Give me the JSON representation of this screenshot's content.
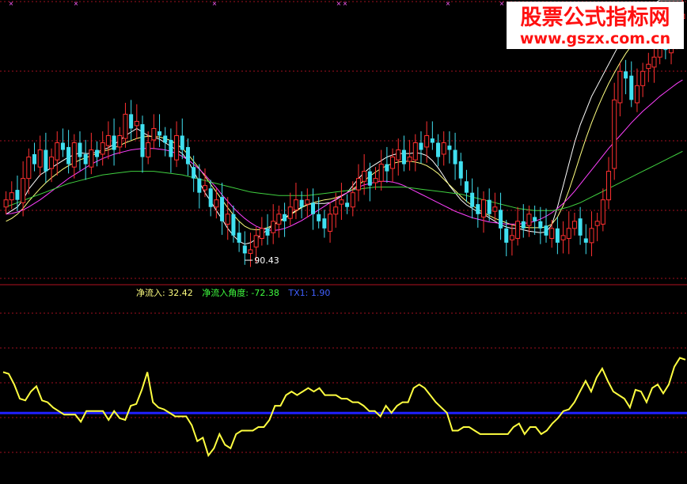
{
  "watermark": {
    "title": "股票公式指标网",
    "url": "www.gszx.com.cn"
  },
  "colors": {
    "background": "#000000",
    "grid": "#a01020",
    "divider": "#b01020",
    "up_candle": "#ff3030",
    "down_candle": "#40e0f0",
    "ma_short": "#ffffff",
    "ma_mid": "#ffff80",
    "ma_long": "#ff40ff",
    "ma_longest": "#40d040",
    "indicator_line": "#ffff40",
    "zero_line": "#2020ff",
    "label_yellow": "#ffff80",
    "label_green": "#40ff40",
    "label_blue": "#4060ff",
    "marker": "#ff60ff",
    "watermark_red": "#ff1010"
  },
  "chart_data": [
    {
      "type": "candlestick",
      "panel": "price",
      "low_annotation": {
        "value": "90.43",
        "bar_index": 42
      },
      "ylim": [
        87,
        126
      ],
      "bars_close": [
        98,
        99,
        98,
        101,
        104,
        103,
        105,
        102,
        104,
        106,
        105,
        103,
        106,
        104,
        103,
        105,
        104,
        106,
        107,
        105,
        107,
        110,
        108,
        109,
        104,
        106,
        108,
        107,
        106,
        104,
        107,
        105,
        103,
        101,
        99,
        100,
        97,
        98,
        95,
        96,
        93,
        92,
        90.5,
        91,
        93,
        94,
        93,
        95,
        96,
        95,
        97,
        98,
        97,
        98,
        96,
        95,
        94,
        96,
        97,
        98,
        97,
        99,
        101,
        102,
        100,
        101,
        103,
        102,
        104,
        105,
        103,
        104,
        106,
        105,
        107,
        106,
        104,
        106,
        105,
        103,
        101,
        99,
        97,
        96,
        98,
        96,
        97,
        94,
        92,
        93,
        95,
        94,
        96,
        95,
        94,
        93,
        94,
        92,
        93,
        94,
        95,
        93,
        92,
        94,
        95,
        98,
        102,
        112,
        116,
        115,
        112,
        114,
        116,
        117,
        118,
        120,
        119,
        121,
        123,
        124
      ],
      "ma_lines": [
        {
          "values": [
            96,
            96.5,
            97,
            98,
            99.5,
            100.5,
            101.5,
            102,
            102.5,
            103,
            103.5,
            104,
            104.3,
            104.6,
            104.5,
            104.5,
            104.7,
            105,
            105.3,
            105.8,
            106.3,
            107,
            107.5,
            108,
            107.5,
            107,
            106.8,
            106.5,
            106,
            105.5,
            105,
            104.5,
            103.5,
            102,
            100.5,
            99,
            97.8,
            96.5,
            95.3,
            94,
            93,
            92.2,
            91.8,
            92,
            92.5,
            93.2,
            93.8,
            94.5,
            95,
            95.5,
            96,
            96.5,
            97,
            97.3,
            97.5,
            97.5,
            97.5,
            97.6,
            98,
            98.5,
            99,
            100,
            101,
            101.8,
            102.5,
            103,
            103.5,
            104,
            104.3,
            104.5,
            104.5,
            104.5,
            104.6,
            104.5,
            104.2,
            103.5,
            102.5,
            101.3,
            100,
            99,
            98,
            97.3,
            96.8,
            96.3,
            96,
            95.5,
            95,
            94.5,
            94.2,
            94,
            94,
            93.8,
            93.6,
            93.5,
            93.4,
            93.5,
            94.5,
            97,
            100,
            103,
            106,
            108.5,
            110.5,
            112.5,
            114,
            115.5,
            117,
            118.5,
            120,
            121.5,
            122.5,
            123.5,
            124.5,
            125,
            125.5,
            126,
            126,
            126,
            126,
            126
          ]
        },
        {
          "values": [
            95,
            95.4,
            96,
            96.8,
            97.8,
            98.7,
            99.6,
            100.4,
            101.1,
            101.7,
            102.3,
            102.8,
            103.2,
            103.6,
            103.9,
            104.2,
            104.5,
            104.8,
            105,
            105.3,
            105.6,
            106,
            106.3,
            106.6,
            106.8,
            106.9,
            106.9,
            106.8,
            106.6,
            106.3,
            105.8,
            105.2,
            104.4,
            103.4,
            102.4,
            101.3,
            100.2,
            99.1,
            98,
            96.9,
            95.9,
            95,
            94.3,
            93.9,
            93.8,
            93.9,
            94.1,
            94.5,
            94.9,
            95.4,
            95.9,
            96.4,
            96.9,
            97.3,
            97.6,
            97.8,
            98,
            98.1,
            98.3,
            98.6,
            99,
            99.5,
            100.1,
            100.7,
            101.3,
            101.9,
            102.4,
            102.8,
            103.1,
            103.3,
            103.4,
            103.4,
            103.3,
            103.1,
            102.8,
            102.3,
            101.7,
            100.9,
            100.1,
            99.3,
            98.5,
            97.8,
            97.2,
            96.7,
            96.2,
            95.8,
            95.4,
            95.1,
            94.8,
            94.5,
            94.3,
            94.2,
            94.1,
            94.1,
            94.1,
            94.2,
            94.6,
            95.6,
            97.2,
            99.3,
            101.7,
            104.2,
            106.6,
            108.8,
            110.8,
            112.6,
            114.3,
            115.8,
            117.2,
            118.5,
            119.6,
            120.6,
            121.5,
            122.3,
            123,
            123.6,
            124.1,
            124.5,
            124.8,
            125
          ]
        },
        {
          "values": [
            96,
            96.1,
            96.3,
            96.6,
            97,
            97.5,
            98,
            98.6,
            99.2,
            99.8,
            100.4,
            101,
            101.5,
            102,
            102.5,
            103,
            103.4,
            103.8,
            104.1,
            104.4,
            104.6,
            104.8,
            105,
            105.1,
            105.2,
            105.2,
            105.2,
            105.1,
            105,
            104.8,
            104.5,
            104.1,
            103.6,
            103,
            102.3,
            101.5,
            100.6,
            99.7,
            98.7,
            97.8,
            96.9,
            96.1,
            95.4,
            94.8,
            94.3,
            94,
            93.8,
            93.7,
            93.8,
            94,
            94.3,
            94.7,
            95.1,
            95.6,
            96.1,
            96.6,
            97.1,
            97.6,
            98.1,
            98.6,
            99,
            99.4,
            99.8,
            100.1,
            100.3,
            100.5,
            100.6,
            100.6,
            100.5,
            100.3,
            100,
            99.6,
            99.2,
            98.8,
            98.4,
            98,
            97.6,
            97.2,
            96.8,
            96.4,
            96.1,
            95.8,
            95.5,
            95.3,
            95.1,
            94.9,
            94.8,
            94.7,
            94.6,
            94.6,
            94.6,
            94.7,
            94.8,
            95,
            95.3,
            95.7,
            96.2,
            96.8,
            97.5,
            98.3,
            99.2,
            100.2,
            101.2,
            102.2,
            103.2,
            104.2,
            105.2,
            106.1,
            107,
            107.9,
            108.8,
            109.6,
            110.4,
            111.1,
            111.8,
            112.5,
            113.1,
            113.7,
            114.3,
            114.8
          ]
        },
        {
          "values": [
            97,
            97.3,
            97.6,
            97.9,
            98.2,
            98.5,
            98.8,
            99.1,
            99.4,
            99.7,
            100,
            100.3,
            100.5,
            100.7,
            100.9,
            101.1,
            101.3,
            101.5,
            101.6,
            101.7,
            101.8,
            101.9,
            102,
            102,
            102,
            102,
            102,
            101.9,
            101.8,
            101.7,
            101.6,
            101.5,
            101.3,
            101.1,
            100.9,
            100.7,
            100.5,
            100.3,
            100.1,
            99.9,
            99.7,
            99.5,
            99.3,
            99.1,
            99,
            98.9,
            98.8,
            98.7,
            98.6,
            98.6,
            98.6,
            98.6,
            98.6,
            98.6,
            98.7,
            98.8,
            98.9,
            99,
            99.1,
            99.2,
            99.3,
            99.4,
            99.5,
            99.6,
            99.7,
            99.8,
            99.8,
            99.8,
            99.8,
            99.8,
            99.8,
            99.7,
            99.6,
            99.5,
            99.4,
            99.3,
            99.2,
            99.1,
            99,
            98.9,
            98.8,
            98.6,
            98.4,
            98.2,
            98,
            97.8,
            97.6,
            97.4,
            97.2,
            97,
            96.8,
            96.7,
            96.6,
            96.5,
            96.5,
            96.5,
            96.5,
            96.6,
            96.8,
            97,
            97.3,
            97.6,
            98,
            98.4,
            98.8,
            99.2,
            99.6,
            100,
            100.4,
            100.8,
            101.2,
            101.6,
            102,
            102.4,
            102.8,
            103.2,
            103.6,
            104,
            104.4,
            104.8
          ]
        }
      ]
    },
    {
      "type": "line",
      "panel": "indicator",
      "labels": [
        {
          "name": "净流入",
          "value": "32.42"
        },
        {
          "name": "净流入角度",
          "value": "-72.38"
        },
        {
          "name": "TX1",
          "value": "1.90"
        }
      ],
      "baseline_value": 1.9,
      "ylim": [
        -35,
        60
      ],
      "values": [
        25,
        24,
        18,
        10,
        9,
        14,
        17,
        9,
        8,
        5,
        3,
        1,
        1,
        1,
        -3,
        3,
        3,
        3,
        3,
        -2,
        3,
        -1,
        -2,
        6,
        7,
        15,
        25,
        8,
        5,
        4,
        2,
        0,
        0,
        0,
        -5,
        -14,
        -12,
        -22,
        -18,
        -10,
        -16,
        -18,
        -10,
        -8,
        -8,
        -8,
        -6,
        -6,
        -2,
        6,
        6,
        12,
        14,
        12,
        14,
        16,
        14,
        16,
        12,
        12,
        12,
        10,
        10,
        8,
        8,
        6,
        3,
        3,
        0,
        6,
        2,
        6,
        8,
        8,
        16,
        18,
        16,
        12,
        8,
        5,
        2,
        -8,
        -8,
        -6,
        -6,
        -8,
        -10,
        -10,
        -10,
        -10,
        -10,
        -10,
        -6,
        -4,
        -10,
        -6,
        -6,
        -10,
        -8,
        -4,
        -1,
        3,
        4,
        8,
        14,
        20,
        14,
        22,
        27,
        20,
        14,
        12,
        10,
        5,
        15,
        14,
        8,
        16,
        18,
        13,
        18,
        28,
        33,
        32
      ]
    }
  ]
}
